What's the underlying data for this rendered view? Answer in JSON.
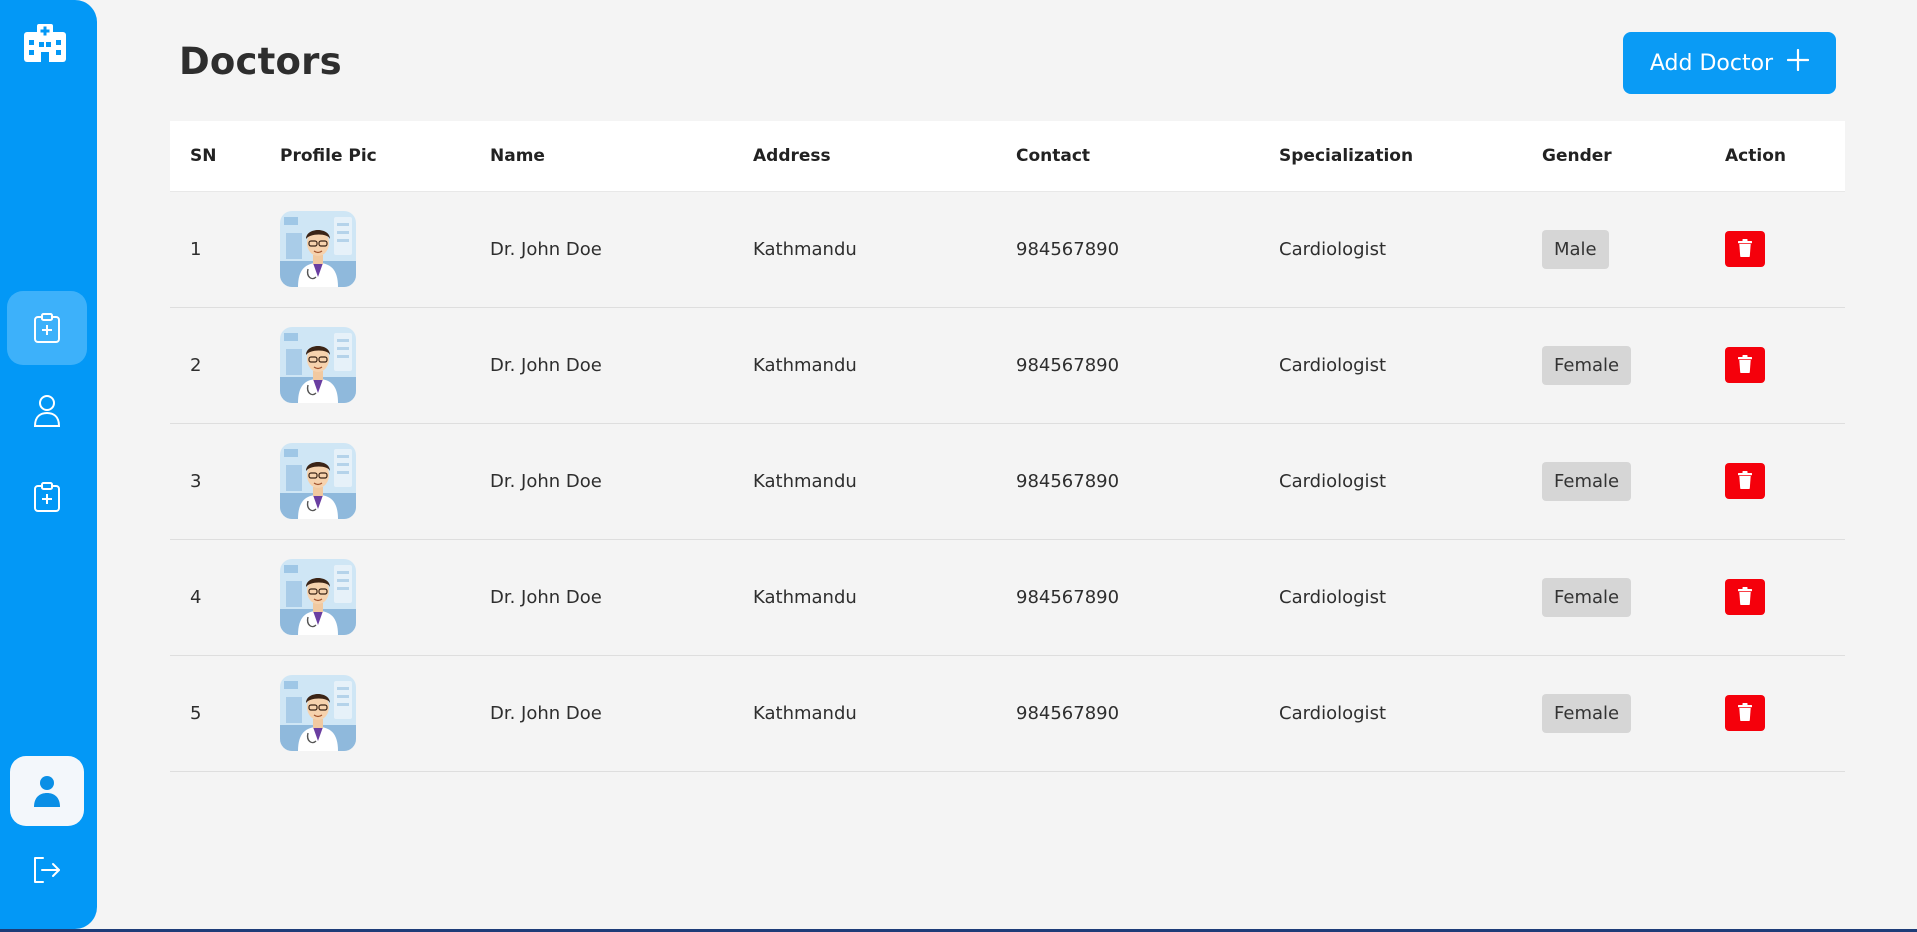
{
  "page": {
    "title": "Doctors",
    "add_button_label": "Add Doctor"
  },
  "sidebar": {
    "logo_icon": "hospital-icon",
    "items": [
      {
        "icon": "clipboard-plus-icon",
        "active": true
      },
      {
        "icon": "user-outline-icon",
        "active": false
      },
      {
        "icon": "clipboard-plus-icon",
        "active": false
      },
      {
        "icon": "user-filled-icon",
        "active": false
      },
      {
        "icon": "logout-icon",
        "active": false
      }
    ]
  },
  "table": {
    "headers": [
      "SN",
      "Profile Pic",
      "Name",
      "Address",
      "Contact",
      "Specialization",
      "Gender",
      "Action"
    ],
    "rows": [
      {
        "sn": "1",
        "name": "Dr. John Doe",
        "address": "Kathmandu",
        "contact": "984567890",
        "specialization": "Cardiologist",
        "gender": "Male"
      },
      {
        "sn": "2",
        "name": "Dr. John Doe",
        "address": "Kathmandu",
        "contact": "984567890",
        "specialization": "Cardiologist",
        "gender": "Female"
      },
      {
        "sn": "3",
        "name": "Dr. John Doe",
        "address": "Kathmandu",
        "contact": "984567890",
        "specialization": "Cardiologist",
        "gender": "Female"
      },
      {
        "sn": "4",
        "name": "Dr. John Doe",
        "address": "Kathmandu",
        "contact": "984567890",
        "specialization": "Cardiologist",
        "gender": "Female"
      },
      {
        "sn": "5",
        "name": "Dr. John Doe",
        "address": "Kathmandu",
        "contact": "984567890",
        "specialization": "Cardiologist",
        "gender": "Female"
      }
    ]
  },
  "colors": {
    "sidebar": "#0398f6",
    "primary_button": "#0a9bf5",
    "delete_button": "#f5000b",
    "badge": "#d6d6d6"
  }
}
